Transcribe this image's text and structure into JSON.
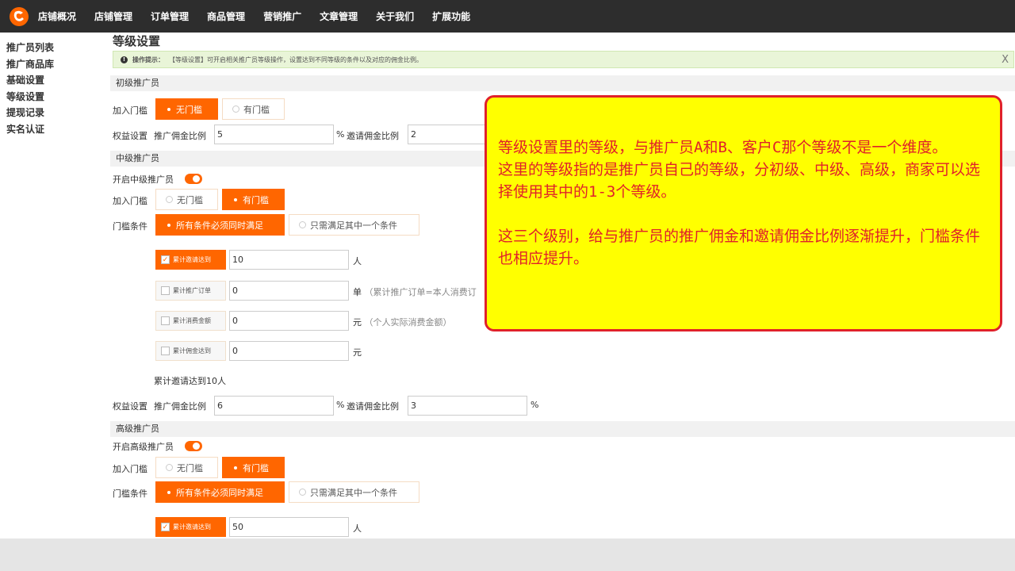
{
  "nav": {
    "items": [
      "店铺概况",
      "店铺管理",
      "订单管理",
      "商品管理",
      "营销推广",
      "文章管理",
      "关于我们",
      "扩展功能"
    ]
  },
  "sidebar": {
    "items": [
      "推广员列表",
      "推广商品库",
      "基础设置",
      "等级设置",
      "提现记录",
      "实名认证"
    ]
  },
  "page": {
    "title": "等级设置",
    "tip_label": "操作提示：",
    "tip_text": "【等级设置】可开启相关推广员等级操作，设置达到不同等级的条件以及对应的佣金比例。",
    "close": "X"
  },
  "labels": {
    "join_threshold": "加入门槛",
    "rights": "权益设置",
    "threshold_cond": "门槛条件",
    "promo_ratio": "推广佣金比例",
    "invite_ratio": "邀请佣金比例",
    "percent": "%",
    "no_threshold": "无门槛",
    "has_threshold": "有门槛",
    "all_conditions": "所有条件必须同时满足",
    "any_condition": "只需满足其中一个条件",
    "cum_invite": "累计邀请达到",
    "cum_orders": "累计推广订单",
    "cum_spend": "累计消费金额",
    "cum_commission": "累计佣金达到",
    "unit_person": "人",
    "unit_order": "单",
    "unit_order_hint": "（累计推广订单=本人消费订",
    "unit_yuan": "元",
    "unit_yuan_hint": "（个人实际消费金额）"
  },
  "primary": {
    "section": "初级推广员",
    "promo_value": "5",
    "invite_value": "2"
  },
  "middle": {
    "section": "中级推广员",
    "enable_label": "开启中级推广员",
    "invite_count": "10",
    "orders": "0",
    "spend": "0",
    "commission": "0",
    "summary": "累计邀请达到10人",
    "promo_value": "6",
    "invite_value": "3"
  },
  "senior": {
    "section": "高级推广员",
    "enable_label": "开启高级推广员",
    "invite_count": "50"
  },
  "callout": {
    "line1": "等级设置里的等级，与推广员A和B、客户C那个等级不是一个维度。",
    "line2": "这里的等级指的是推广员自己的等级，分初级、中级、高级，商家可以选择使用其中的1-3个等级。",
    "line3": "这三个级别，给与推广员的推广佣金和邀请佣金比例逐渐提升，门槛条件也相应提升。"
  },
  "colors": {
    "accent": "#ff6600",
    "topbar": "#2d2d2d",
    "callout_bg": "#ffff00",
    "callout_text": "#e0212a"
  }
}
